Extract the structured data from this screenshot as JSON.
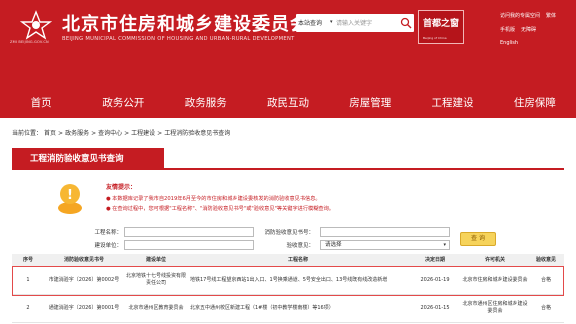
{
  "header": {
    "logo_text": "ZMI BEIJING.GOV.CN",
    "title": "北京市住房和城乡建设委员会",
    "subtitle": "BEIJING MUNICIPAL COMMISSION OF HOUSING AND URBAN-RURAL DEVELOPMENT",
    "search_scope": "本站查询",
    "search_placeholder": "请输入关键字",
    "stamp_text": "首都之窗",
    "stamp_sub": "Beijing of China",
    "links": [
      "访问我的专属空间",
      "繁体",
      "手机版",
      "无障碍",
      "English"
    ]
  },
  "nav": [
    "首页",
    "政务公开",
    "政务服务",
    "政民互动",
    "房屋管理",
    "工程建设",
    "住房保障"
  ],
  "breadcrumb": {
    "prefix": "当前位置：",
    "items": [
      "首页",
      "政务服务",
      "查询中心",
      "工程建设",
      "工程消防验收意见书查询"
    ]
  },
  "section_title": "工程消防验收意见书查询",
  "tip": {
    "title": "友情提示：",
    "lines": [
      "● 本数据库记录了我市自2019年6月至今的市住房和城乡建设委核发的消防验收意见书信息。",
      "● 在查询过程中，您可根据\"工程名称\"、\"消防验收意见书号\"或\"验收意见\"等关键字进行模糊查询。"
    ]
  },
  "form": {
    "project_name_label": "工程名称：",
    "opinion_no_label": "消防验收意见书号：",
    "build_unit_label": "建设单位：",
    "opinion_label": "验收意见：",
    "opinion_value": "请选择",
    "query_button": "查 询"
  },
  "table": {
    "headers": [
      "序号",
      "消防验收意见书号",
      "建设单位",
      "工程名称",
      "决定日期",
      "许可机关",
      "验收意见"
    ],
    "rows": [
      {
        "no": "1",
        "opinion_no": "市建消验字〔2026〕第0002号",
        "unit": "北京地铁十七号线投资有限责任公司",
        "project": "地铁17号线工程望京西站1出入口、1号换乘通道、5号安全出口、13号线既有线改造新增",
        "date": "2026-01-19",
        "authority": "北京市住房和城乡建设委员会",
        "result": "合格"
      },
      {
        "no": "2",
        "opinion_no": "通建消验字〔2026〕第0001号",
        "unit": "北京市通州区教育委员会",
        "project": "北京五中通州校区新建工程（1#楼（初中教学楼南楼）等16项）",
        "date": "2026-01-15",
        "authority": "北京市通州区住房和城乡建设委员会",
        "result": "合格"
      }
    ]
  },
  "colors": {
    "brand": "#c51c22",
    "highlight": "#e34a4a",
    "button": "#f6d35b"
  }
}
